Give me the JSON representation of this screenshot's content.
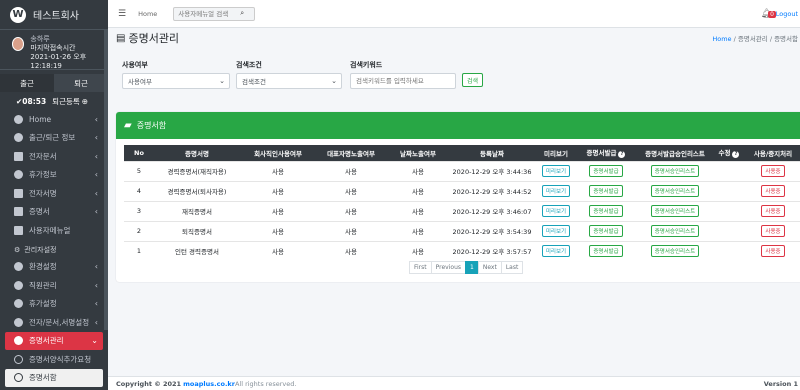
{
  "brand": {
    "logo": "W",
    "name": "테스트회사"
  },
  "user": {
    "name": "송하루",
    "subtitle": "마지막접속시간",
    "time": "2021-01-26 오후 12:18:19"
  },
  "attendance": {
    "in_label": "출근",
    "out_label": "퇴근",
    "clock": "08:53",
    "out_register": "퇴근등록"
  },
  "sidebar": {
    "items": [
      {
        "label": "Home",
        "arrow": "‹"
      },
      {
        "label": "출근/퇴근 정보",
        "arrow": "‹"
      },
      {
        "label": "전자문서",
        "arrow": "‹"
      },
      {
        "label": "휴가정보",
        "arrow": "‹"
      },
      {
        "label": "전자서명",
        "arrow": "‹"
      },
      {
        "label": "증명서",
        "arrow": "‹"
      },
      {
        "label": "사용자메뉴얼",
        "arrow": ""
      }
    ],
    "admin_header": "관리자설정",
    "admin_items": [
      {
        "label": "환경설정",
        "arrow": "‹"
      },
      {
        "label": "직원관리",
        "arrow": "‹"
      },
      {
        "label": "휴가설정",
        "arrow": "‹"
      },
      {
        "label": "전자/문서,서명설정",
        "arrow": "‹"
      },
      {
        "label": "증명서관리",
        "arrow": "⌄"
      }
    ],
    "sub_items": [
      {
        "label": "증명서양식추가요청"
      },
      {
        "label": "증명서함"
      }
    ]
  },
  "topnav": {
    "home": "Home",
    "search_placeholder": "사용자메뉴얼 검색",
    "badge": "0",
    "logout": "Logout"
  },
  "page": {
    "title": "증명서관리",
    "breadcrumb_home": "Home",
    "breadcrumb_rest": " /  증명서관리 / 증명서함"
  },
  "filters": {
    "use_label": "사용여부",
    "use_value": "사용여부",
    "cond_label": "검색조건",
    "cond_value": "검색조건",
    "kw_label": "검색키워드",
    "kw_placeholder": "검색키워드를 입력하세요",
    "search_button": "검색"
  },
  "card": {
    "title": "증명서함"
  },
  "table": {
    "headers": [
      "No",
      "증명서명",
      "회사직인사용여부",
      "대표자명노출여부",
      "날짜노출여부",
      "등록날짜",
      "미리보기",
      "증명서발급",
      "증명서발급승인리스트",
      "수정",
      "사용/중지처리"
    ],
    "rows": [
      {
        "no": "5",
        "name": "경력증명서(재직자용)",
        "seal": "사용",
        "rep": "사용",
        "date_show": "사용",
        "reg": "2020-12-29 오후 3:44:36",
        "preview": "미리보기",
        "issue": "증명서발급",
        "approve": "증명서승인리스트",
        "edit": "",
        "status": "사용중"
      },
      {
        "no": "4",
        "name": "경력증명서(퇴사자용)",
        "seal": "사용",
        "rep": "사용",
        "date_show": "사용",
        "reg": "2020-12-29 오후 3:44:52",
        "preview": "미리보기",
        "issue": "증명서발급",
        "approve": "증명서승인리스트",
        "edit": "",
        "status": "사용중"
      },
      {
        "no": "3",
        "name": "재직증명서",
        "seal": "사용",
        "rep": "사용",
        "date_show": "사용",
        "reg": "2020-12-29 오후 3:46:07",
        "preview": "미리보기",
        "issue": "증명서발급",
        "approve": "증명서승인리스트",
        "edit": "",
        "status": "사용중"
      },
      {
        "no": "2",
        "name": "퇴직증명서",
        "seal": "사용",
        "rep": "사용",
        "date_show": "사용",
        "reg": "2020-12-29 오후 3:54:39",
        "preview": "미리보기",
        "issue": "증명서발급",
        "approve": "증명서승인리스트",
        "edit": "",
        "status": "사용중"
      },
      {
        "no": "1",
        "name": "인턴 경력증명서",
        "seal": "사용",
        "rep": "사용",
        "date_show": "사용",
        "reg": "2020-12-29 오후 3:57:57",
        "preview": "미리보기",
        "issue": "증명서발급",
        "approve": "증명서승인리스트",
        "edit": "",
        "status": "사용중"
      }
    ]
  },
  "pager": {
    "first": "First",
    "prev": "Previous",
    "current": "1",
    "next": "Next",
    "last": "Last"
  },
  "footer": {
    "copyright": "Copyright © 2021",
    "domain": "moaplus.co.kr",
    "rights": " All rights reserved.",
    "version": "Version 1"
  },
  "colors": {
    "accent": "#28a745",
    "sidebar": "#343a40",
    "active": "#dc3545",
    "info": "#17a2b8"
  }
}
